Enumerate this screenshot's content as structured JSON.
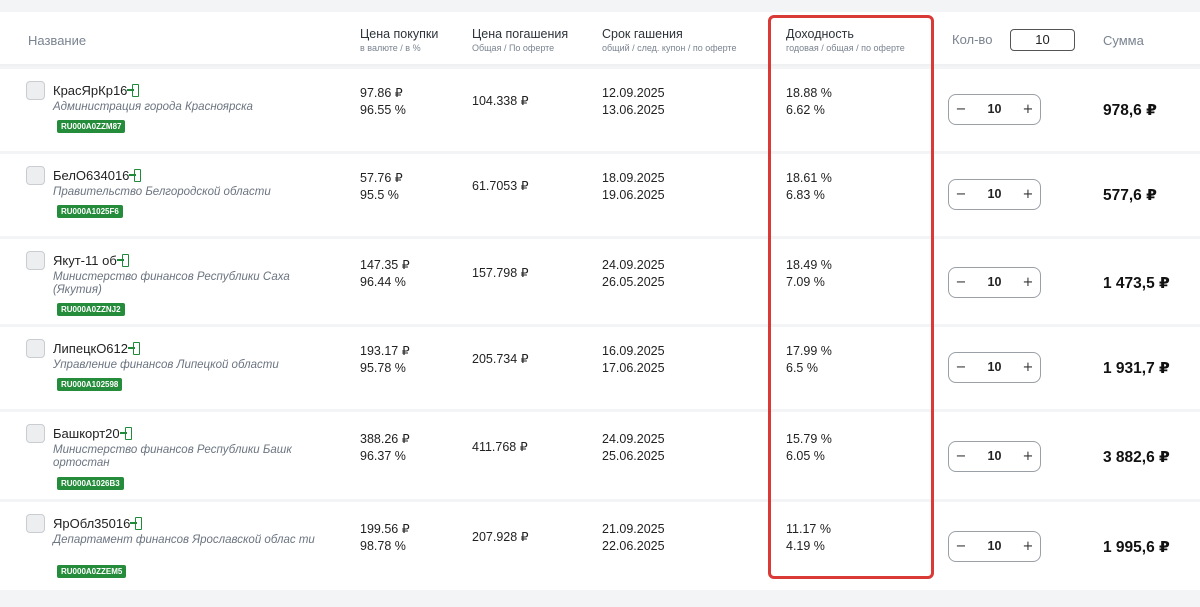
{
  "header": {
    "name": "Название",
    "buy_title": "Цена покупки",
    "buy_sub": "в валюте / в %",
    "redeem_title": "Цена погашения",
    "redeem_sub": "Общая / По оферте",
    "term_title": "Срок гашения",
    "term_sub": "общий / след. купон / по оферте",
    "yield_title": "Доходность",
    "yield_sub": "годовая / общая / по оферте",
    "qty_label": "Кол-во",
    "qty_value": "10",
    "sum_label": "Сумма"
  },
  "rows": [
    {
      "ticker": "КрасЯрКр16",
      "issuer": "Администрация города Красноярска",
      "isin": "RU000A0ZZM87",
      "buy_price": "97.86 ₽",
      "buy_pct": "96.55 %",
      "redeem": "104.338 ₽",
      "date1": "12.09.2025",
      "date2": "13.06.2025",
      "yield1": "18.88 %",
      "yield2": "6.62 %",
      "qty": "10",
      "minus": "−",
      "plus": "+",
      "sum": "978,6 ₽"
    },
    {
      "ticker": "БелО634016",
      "issuer": "Правительство Белгородской области",
      "isin": "RU000A1025F6",
      "buy_price": "57.76 ₽",
      "buy_pct": "95.5 %",
      "redeem": "61.7053 ₽",
      "date1": "18.09.2025",
      "date2": "19.06.2025",
      "yield1": "18.61 %",
      "yield2": "6.83 %",
      "qty": "10",
      "minus": "−",
      "plus": "+",
      "sum": "577,6 ₽"
    },
    {
      "ticker": "Якут-11 об",
      "issuer": "Министерство финансов Республики Саха (Якутия)",
      "isin": "RU000A0ZZNJ2",
      "buy_price": "147.35 ₽",
      "buy_pct": "96.44 %",
      "redeem": "157.798 ₽",
      "date1": "24.09.2025",
      "date2": "26.05.2025",
      "yield1": "18.49 %",
      "yield2": "7.09 %",
      "qty": "10",
      "minus": "−",
      "plus": "+",
      "sum": "1 473,5 ₽"
    },
    {
      "ticker": "ЛипецкО612",
      "issuer": "Управление финансов Липецкой области",
      "isin": "RU000A102598",
      "buy_price": "193.17 ₽",
      "buy_pct": "95.78 %",
      "redeem": "205.734 ₽",
      "date1": "16.09.2025",
      "date2": "17.06.2025",
      "yield1": "17.99 %",
      "yield2": "6.5 %",
      "qty": "10",
      "minus": "−",
      "plus": "+",
      "sum": "1 931,7 ₽"
    },
    {
      "ticker": "Башкорт20",
      "issuer": "Министерство финансов Республики Башк ортостан",
      "isin": "RU000A1026B3",
      "buy_price": "388.26 ₽",
      "buy_pct": "96.37 %",
      "redeem": "411.768 ₽",
      "date1": "24.09.2025",
      "date2": "25.06.2025",
      "yield1": "15.79 %",
      "yield2": "6.05 %",
      "qty": "10",
      "minus": "−",
      "plus": "+",
      "sum": "3 882,6 ₽"
    },
    {
      "ticker": "ЯрОбл35016",
      "issuer": "Департамент финансов Ярославской облас ти",
      "isin": "RU000A0ZZEM5",
      "buy_price": "199.56 ₽",
      "buy_pct": "98.78 %",
      "redeem": "207.928 ₽",
      "date1": "21.09.2025",
      "date2": "22.06.2025",
      "yield1": "11.17 %",
      "yield2": "4.19 %",
      "qty": "10",
      "minus": "−",
      "plus": "+",
      "sum": "1 995,6 ₽"
    }
  ],
  "colors": {
    "accent_green": "#258c3b",
    "highlight_red": "#d93a36"
  }
}
